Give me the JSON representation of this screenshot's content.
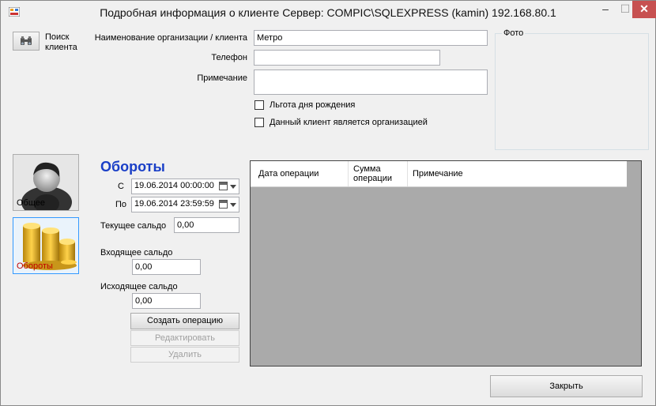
{
  "window": {
    "title": "Подробная информация о клиенте  Сервер: COMPIC\\SQLEXPRESS (kamin) 192.168.80.1",
    "minimize": "–",
    "maximize": "☐",
    "close": "✕"
  },
  "search": {
    "label_line1": "Поиск",
    "label_line2": "клиента"
  },
  "form": {
    "org_label": "Наименование организации / клиента",
    "org_value": "Метро",
    "phone_label": "Телефон",
    "phone_value": "",
    "note_label": "Примечание",
    "note_value": "",
    "birthday_label": "Льгота дня рождения",
    "is_org_label": "Данный клиент является организацией"
  },
  "photo": {
    "title": "Фото"
  },
  "nav": {
    "general_label": "Общее",
    "turnover_label": "Обороты"
  },
  "turnover": {
    "heading": "Обороты",
    "from_label": "С",
    "from_value": "19.06.2014 00:00:00",
    "to_label": "По",
    "to_value": "19.06.2014 23:59:59",
    "current_balance_label": "Текущее сальдо",
    "current_balance_value": "0,00",
    "incoming_balance_label": "Входящее сальдо",
    "incoming_balance_value": "0,00",
    "outgoing_balance_label": "Исходящее сальдо",
    "outgoing_balance_value": "0,00",
    "create_button": "Создать операцию",
    "edit_button": "Редактировать",
    "delete_button": "Удалить"
  },
  "grid": {
    "col1": "Дата операции",
    "col2_line1": "Сумма",
    "col2_line2": "операции",
    "col3": "Примечание"
  },
  "footer": {
    "close_button": "Закрыть"
  },
  "colors": {
    "heading": "#1a3fc7",
    "close_bg": "#c75050",
    "grid_bg": "#aaaaaa"
  }
}
